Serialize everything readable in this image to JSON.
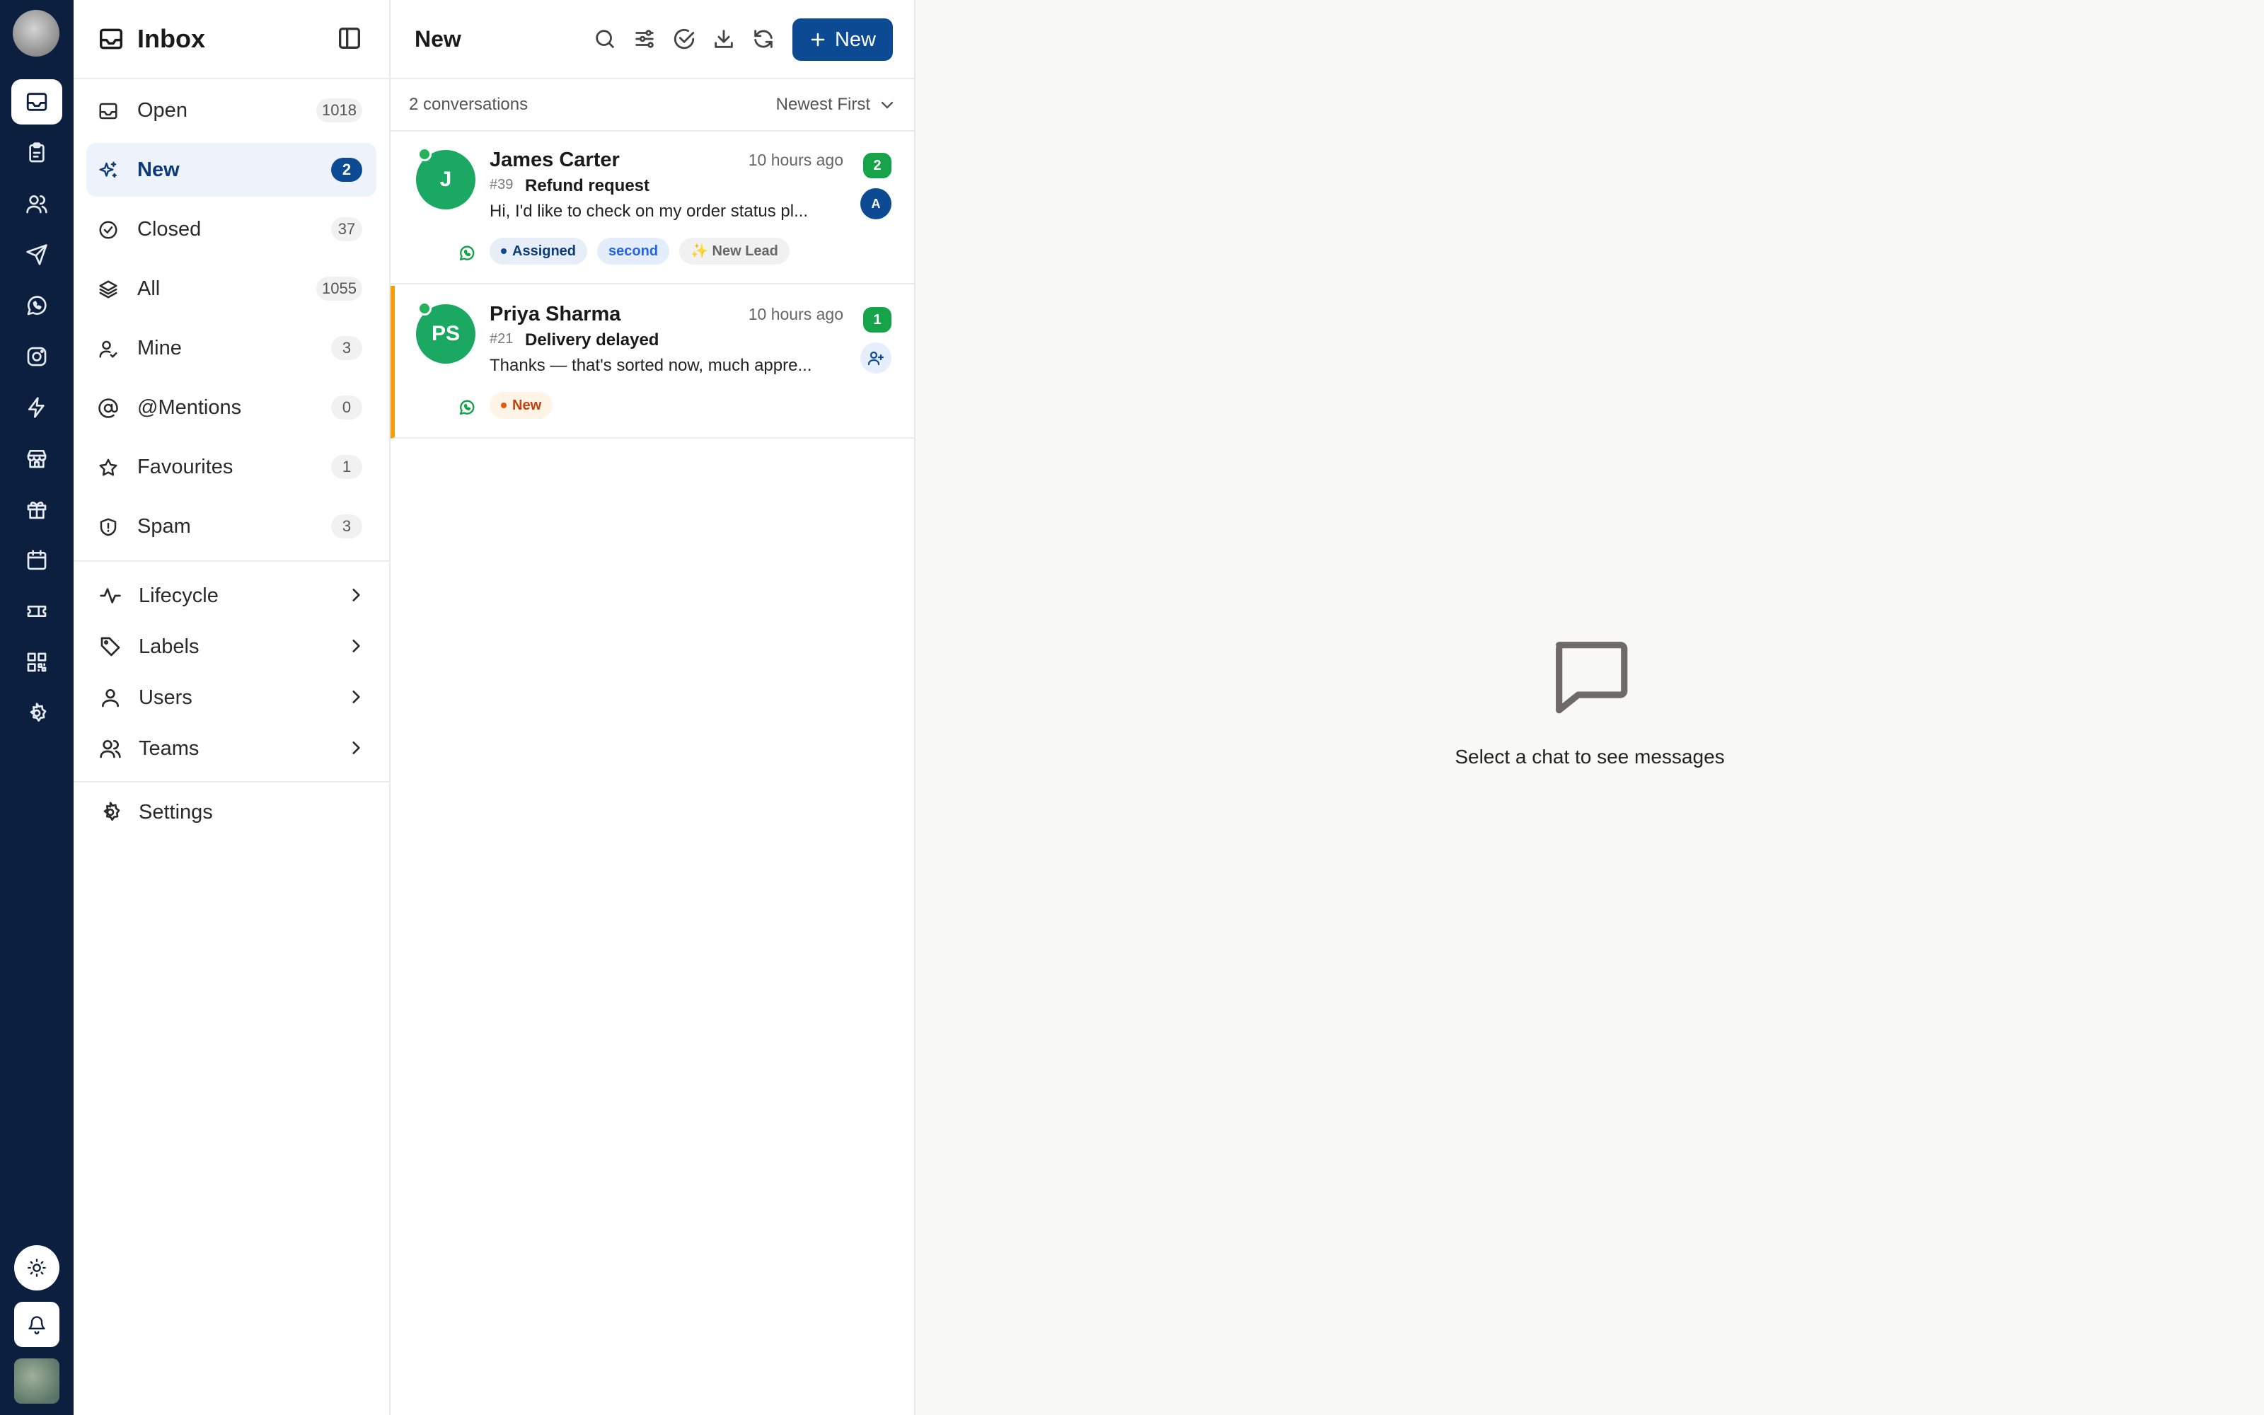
{
  "sidebar": {
    "title": "Inbox",
    "items": [
      {
        "label": "Open",
        "count": "1018"
      },
      {
        "label": "New",
        "count": "2"
      },
      {
        "label": "Closed",
        "count": "37"
      },
      {
        "label": "All",
        "count": "1055"
      },
      {
        "label": "Mine",
        "count": "3"
      },
      {
        "label": "@Mentions",
        "count": "0"
      },
      {
        "label": "Favourites",
        "count": "1"
      },
      {
        "label": "Spam",
        "count": "3"
      }
    ],
    "groups": [
      {
        "label": "Lifecycle"
      },
      {
        "label": "Labels"
      },
      {
        "label": "Users"
      },
      {
        "label": "Teams"
      }
    ],
    "settings_label": "Settings"
  },
  "list": {
    "title": "New",
    "new_button_label": "New",
    "count_text": "2 conversations",
    "sort_label": "Newest First",
    "conversations": [
      {
        "initials": "J",
        "name": "James Carter",
        "time": "10 hours ago",
        "id": "#39",
        "subject": "Refund request",
        "preview": "Hi, I'd like to check on my order status pl...",
        "unread": "2",
        "assignee": "A",
        "tags": [
          "Assigned",
          "second",
          "✨ New Lead"
        ]
      },
      {
        "initials": "PS",
        "name": "Priya Sharma",
        "time": "10 hours ago",
        "id": "#21",
        "subject": "Delivery delayed",
        "preview": "Thanks — that's sorted now, much appre...",
        "unread": "1",
        "tags": [
          "New"
        ]
      }
    ]
  },
  "empty_state": {
    "text": "Select a chat to see messages"
  },
  "colors": {
    "rail": "#0c1f3f",
    "accent": "#0c4a94",
    "avatar_green": "#1aa862",
    "unread_green": "#16a34a",
    "new_tag_orange": "#c2410c",
    "highlight_border": "#f59e0b"
  }
}
